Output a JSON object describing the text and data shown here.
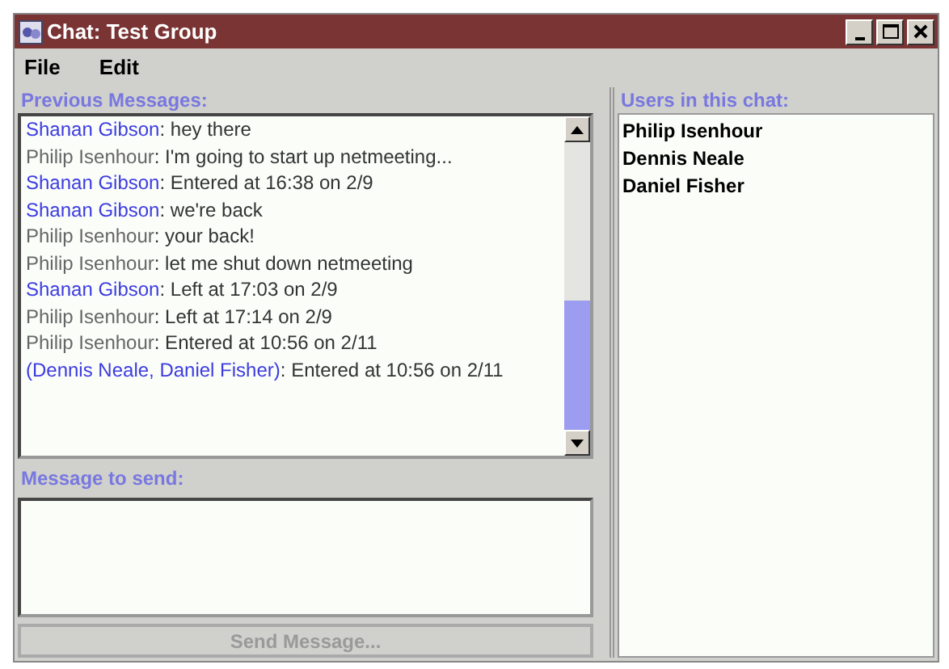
{
  "window": {
    "title": "Chat: Test Group"
  },
  "menu": [
    "File",
    "Edit"
  ],
  "messages_panel": {
    "title": "Previous Messages:",
    "messages": [
      {
        "sender": "Shanan Gibson",
        "color": "#3c3ce0",
        "text": ": hey there"
      },
      {
        "sender": "Philip Isenhour",
        "color": "#666666",
        "text": ": I'm going to start up netmeeting..."
      },
      {
        "sender": "Shanan Gibson",
        "color": "#3c3ce0",
        "text": ": Entered at 16:38 on 2/9"
      },
      {
        "sender": "Shanan Gibson",
        "color": "#3c3ce0",
        "text": ": we're back"
      },
      {
        "sender": "Philip Isenhour",
        "color": "#666666",
        "text": ": your back!"
      },
      {
        "sender": "Philip Isenhour",
        "color": "#666666",
        "text": ": let me shut down netmeeting"
      },
      {
        "sender": "Shanan Gibson",
        "color": "#3c3ce0",
        "text": ": Left at 17:03 on 2/9"
      },
      {
        "sender": "Philip Isenhour",
        "color": "#666666",
        "text": ": Left at 17:14 on 2/9"
      },
      {
        "sender": "Philip Isenhour",
        "color": "#666666",
        "text": ": Entered at 10:56 on 2/11"
      },
      {
        "sender": "(Dennis Neale, Daniel Fisher)",
        "color": "#3c3ce0",
        "text": ": Entered at 10:56 on 2/11"
      }
    ]
  },
  "compose": {
    "title": "Message to send:",
    "send_button": {
      "label": "Send Message...",
      "disabled": true
    }
  },
  "users_panel": {
    "title": "Users in this chat:",
    "users": [
      "Philip Isenhour",
      "Dennis Neale",
      "Daniel Fisher"
    ]
  }
}
